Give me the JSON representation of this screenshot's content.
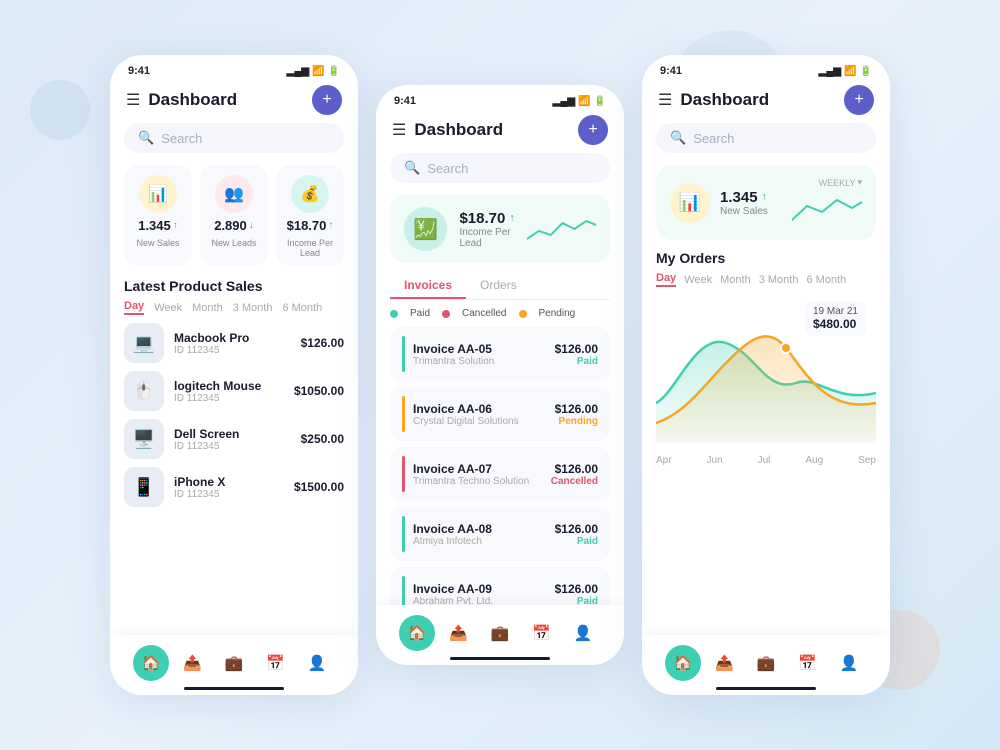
{
  "background": "#dce9f7",
  "phone_left": {
    "status_time": "9:41",
    "header_title": "Dashboard",
    "plus_label": "+",
    "search_placeholder": "Search",
    "stats": [
      {
        "icon": "📊",
        "icon_class": "yellow",
        "value": "1.345",
        "arrow": "↑",
        "arrow_class": "up",
        "label": "New Sales"
      },
      {
        "icon": "👥",
        "icon_class": "pink",
        "value": "2.890",
        "arrow": "↓",
        "arrow_class": "down",
        "label": "New Leads"
      },
      {
        "icon": "💰",
        "icon_class": "teal",
        "value": "$18.70",
        "arrow": "↑",
        "arrow_class": "up",
        "label": "Income Per Lead"
      }
    ],
    "section_title": "Latest Product Sales",
    "tabs": [
      "Day",
      "Week",
      "Month",
      "3 Month",
      "6 Month"
    ],
    "active_tab": 0,
    "products": [
      {
        "name": "Macbook Pro",
        "id": "ID 112345",
        "price": "$126.00",
        "emoji": "💻"
      },
      {
        "name": "logitech Mouse",
        "id": "ID 112345",
        "price": "$1050.00",
        "emoji": "🖱️"
      },
      {
        "name": "Dell Screen",
        "id": "ID 112345",
        "price": "$250.00",
        "emoji": "🖥️"
      },
      {
        "name": "iPhone X",
        "id": "ID 112345",
        "price": "$1500.00",
        "emoji": "📱"
      }
    ],
    "nav_items": [
      "🏠",
      "📤",
      "💼",
      "📅",
      "👤"
    ]
  },
  "phone_center": {
    "status_time": "9:41",
    "header_title": "Dashboard",
    "search_placeholder": "Search",
    "center_stat": {
      "value": "$18.70",
      "arrow": "↑",
      "label": "Income Per Lead"
    },
    "tabs": [
      "Invoices",
      "Orders"
    ],
    "active_tab": 0,
    "legend": [
      {
        "color": "#3ecfb2",
        "label": "Paid"
      },
      {
        "color": "#e05570",
        "label": "Cancelled"
      },
      {
        "color": "#f5a623",
        "label": "Pending"
      }
    ],
    "invoices": [
      {
        "id": "Invoice AA-05",
        "company": "Trimantra Solution",
        "amount": "$126.00",
        "status": "Paid",
        "status_class": "paid",
        "accent": "#3ecfb2"
      },
      {
        "id": "Invoice AA-06",
        "company": "Crystal Digital Solutions",
        "amount": "$126.00",
        "status": "Pending",
        "status_class": "pending",
        "accent": "#f5a623"
      },
      {
        "id": "Invoice AA-07",
        "company": "Trimantra Techno Solution",
        "amount": "$126.00",
        "status": "Cancelled",
        "status_class": "cancelled",
        "accent": "#e05570"
      },
      {
        "id": "Invoice AA-08",
        "company": "Atmiya Infotech",
        "amount": "$126.00",
        "status": "Paid",
        "status_class": "paid",
        "accent": "#3ecfb2"
      },
      {
        "id": "Invoice AA-09",
        "company": "Abraham Pvt. Ltd.",
        "amount": "$126.00",
        "status": "Paid",
        "status_class": "paid",
        "accent": "#3ecfb2"
      }
    ],
    "nav_items": [
      "🏠",
      "📤",
      "💼",
      "📅",
      "👤"
    ]
  },
  "phone_right": {
    "status_time": "9:41",
    "header_title": "Dashboard",
    "search_placeholder": "Search",
    "stat": {
      "value": "1.345",
      "arrow": "↑",
      "label": "New Sales",
      "weekly": "WEEKLY"
    },
    "section_title": "My Orders",
    "tabs": [
      "Day",
      "Week",
      "Month",
      "3 Month",
      "6 Month"
    ],
    "active_tab": 0,
    "chart": {
      "tooltip_date": "19 Mar 21",
      "tooltip_value": "$480.00",
      "x_labels": [
        "Apr",
        "Jun",
        "Jul",
        "Aug",
        "Sep"
      ]
    },
    "nav_items": [
      "🏠",
      "📤",
      "💼",
      "📅",
      "👤"
    ]
  }
}
